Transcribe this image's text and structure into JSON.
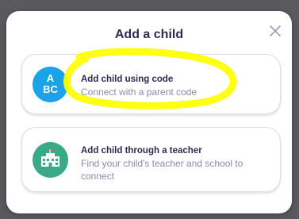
{
  "modal": {
    "title": "Add a child",
    "close_icon": "close-icon"
  },
  "options": [
    {
      "icon": "abc-icon",
      "icon_line1": "A",
      "icon_line2": "BC",
      "icon_color": "#1aa3e8",
      "title": "Add child using code",
      "subtitle": "Connect with a parent code"
    },
    {
      "icon": "school-icon",
      "icon_color": "#3aa985",
      "title": "Add child through a teacher",
      "subtitle": "Find your child's teacher and school to connect"
    }
  ],
  "colors": {
    "title_text": "#2c2a50",
    "subtitle_text": "#8a8aaa",
    "highlight": "#ffff00",
    "backdrop": "#5a5a5e"
  }
}
